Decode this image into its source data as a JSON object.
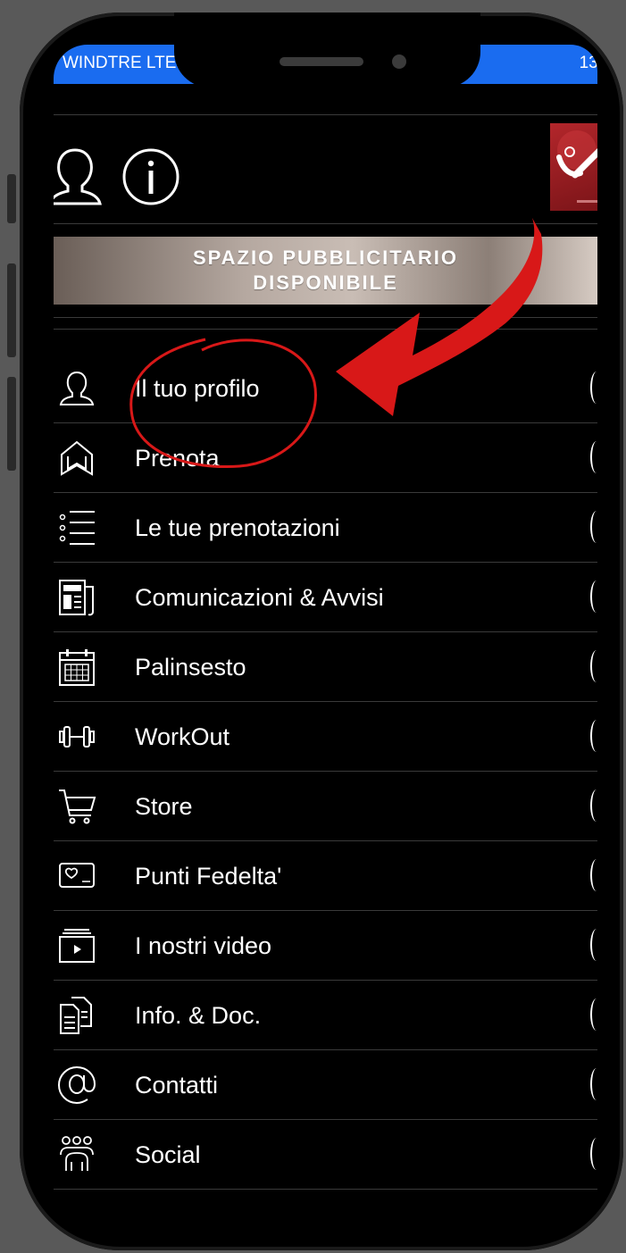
{
  "status_bar": {
    "carrier": "WINDTRE  LTE",
    "time": "13:"
  },
  "banner": {
    "line1": "SPAZIO PUBBLICITARIO",
    "line2": "DISPONIBILE"
  },
  "menu": {
    "items": [
      {
        "label": "Il tuo profilo",
        "icon": "user-icon"
      },
      {
        "label": "Prenota",
        "icon": "bookmark-house-icon"
      },
      {
        "label": "Le tue prenotazioni",
        "icon": "list-icon"
      },
      {
        "label": "Comunicazioni & Avvisi",
        "icon": "newspaper-icon"
      },
      {
        "label": "Palinsesto",
        "icon": "calendar-icon"
      },
      {
        "label": "WorkOut",
        "icon": "dumbbell-icon"
      },
      {
        "label": "Store",
        "icon": "cart-icon"
      },
      {
        "label": "Punti Fedelta'",
        "icon": "loyalty-card-icon"
      },
      {
        "label": "I nostri video",
        "icon": "video-icon"
      },
      {
        "label": "Info. & Doc.",
        "icon": "documents-icon"
      },
      {
        "label": "Contatti",
        "icon": "at-icon"
      },
      {
        "label": "Social",
        "icon": "group-icon"
      }
    ]
  },
  "colors": {
    "status_bar": "#1a6cf0",
    "background": "#000000",
    "annotation": "#d81818"
  }
}
